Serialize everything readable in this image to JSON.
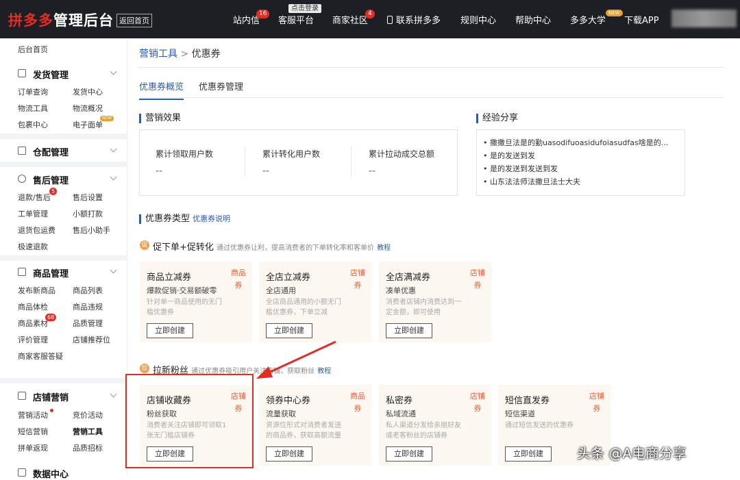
{
  "header": {
    "logo_brand": "拼多多",
    "logo_suffix": "管理后台",
    "back_home": "返回首页",
    "tooltip": "点击登录",
    "nav": [
      {
        "label": "站内信",
        "badge": "16"
      },
      {
        "label": "客服平台"
      },
      {
        "label": "商家社区",
        "badge": "4"
      },
      {
        "label": "联系拼多多"
      },
      {
        "label": "规则中心"
      },
      {
        "label": "帮助中心"
      },
      {
        "label": "多多大学",
        "badge": "NEW"
      },
      {
        "label": "下载APP"
      }
    ]
  },
  "sidebar": {
    "home": "后台首页",
    "groups": [
      {
        "title": "发货管理",
        "items": [
          "订单查询",
          "发货中心",
          "物流工具",
          "物流概况",
          "包裹中心",
          "电子面单"
        ],
        "badge": "NEW"
      },
      {
        "title": "仓配管理",
        "items": []
      },
      {
        "title": "售后管理",
        "items": [
          "退款/售后",
          "售后设置",
          "工单管理",
          "小额打款",
          "退货包运费",
          "售后小助手",
          "极速退款"
        ],
        "badge": "5"
      },
      {
        "title": "商品管理",
        "items": [
          "发布新商品",
          "商品列表",
          "商品体检",
          "商品违规",
          "商品素材",
          "品质管理",
          "评价管理",
          "店铺推荐位",
          "商家客服答疑"
        ],
        "badge": "68"
      },
      {
        "title": "店铺营销",
        "items": [
          "营销活动",
          "竞价活动",
          "短信营销",
          "营销工具",
          "拼单返现",
          "品质招标"
        ]
      },
      {
        "title": "数据中心",
        "items": []
      }
    ]
  },
  "breadcrumb": {
    "parent": "营销工具",
    "sep": ">",
    "current": "优惠券"
  },
  "tabs": [
    "优惠券概览",
    "优惠券管理"
  ],
  "effect": {
    "title": "营销效果",
    "stats": [
      {
        "label": "累计领取用户数",
        "value": "--"
      },
      {
        "label": "累计转化用户数",
        "value": "--"
      },
      {
        "label": "累计拉动成交总额",
        "value": "--"
      }
    ]
  },
  "experience": {
    "title": "经验分享",
    "items": [
      "撒撒旦法是的勤uasodifuoasidufoiasudfas啥是的...",
      "是的发送到发",
      "是的发送到发送到发",
      "山东法法师法撒旦法士大夫"
    ]
  },
  "coupon_types": {
    "title": "优惠券类型",
    "link": "优惠券说明"
  },
  "row1": {
    "icon": "促",
    "title": "促下单+促转化",
    "desc": "通过优惠券让利，提高消费者的下单转化率和客单价",
    "tutorial": "教程",
    "cards": [
      {
        "title": "商品立减券",
        "tag": "商品券",
        "sub": "爆款促销·交易额破零",
        "desc": "针对单一商品使用的无门槛优惠券",
        "btn": "立即创建"
      },
      {
        "title": "全店立减券",
        "tag": "店铺券",
        "sub": "全店通用",
        "desc": "全店商品通用的小额无门槛优惠券，下单立减",
        "btn": "立即创建"
      },
      {
        "title": "全店满减券",
        "tag": "店铺券",
        "sub": "凑单优惠",
        "desc": "消费者店铺内消费达到一定金额，即可使用",
        "btn": "立即创建"
      }
    ]
  },
  "row2": {
    "icon": "拉",
    "title": "拉新粉丝",
    "desc": "通过优惠券吸引用户关注店铺，获取粉丝",
    "tutorial": "教程",
    "cards": [
      {
        "title": "店铺收藏券",
        "tag": "店铺券",
        "sub": "粉丝获取",
        "desc": "消费者关注店铺即可领取1张无门槛店铺券",
        "btn": "立即创建"
      },
      {
        "title": "领券中心券",
        "tag": "商品券",
        "sub": "流量获取",
        "desc": "资源位形式对消费者发送的商品券，获取高额流量",
        "btn": "立即创建"
      },
      {
        "title": "私密券",
        "tag": "店铺券",
        "sub": "私域流通",
        "desc": "私人渠道分发给亲朋好友或老客粉丝的店铺券",
        "btn": "立即创建"
      },
      {
        "title": "短信直发券",
        "tag": "店铺券",
        "sub": "短信渠道",
        "desc": "通过短信发送的优惠券",
        "btn": "立即创建"
      }
    ]
  },
  "watermark": "头条 @A电商分享"
}
